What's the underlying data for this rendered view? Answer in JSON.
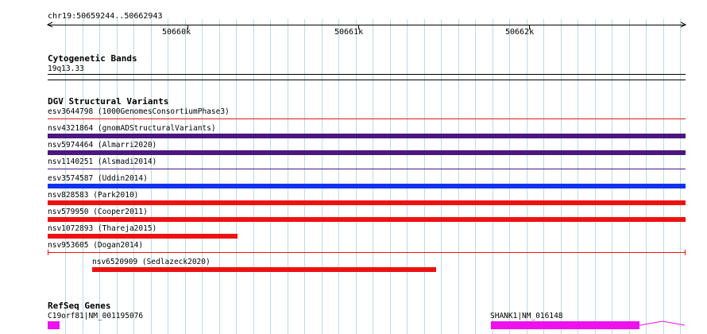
{
  "ruler": {
    "location": "chr19:50659244..50662943",
    "ticks": [
      "50660k",
      "50661k",
      "50662k"
    ]
  },
  "cytoband_track": {
    "title": "Cytogenetic Bands",
    "band": "19q13.33"
  },
  "dgv_track": {
    "title": "DGV Structural Variants",
    "features": [
      {
        "label": "esv3644798 (1000GenomesConsortiumPhase3)",
        "color": "#e01b1b",
        "style": "thin"
      },
      {
        "label": "nsv4321864 (gnomADStructuralVariants)",
        "color": "#4b1780",
        "style": "thick"
      },
      {
        "label": "nsv5974464 (Almarri2020)",
        "color": "#4b1780",
        "style": "thick"
      },
      {
        "label": "nsv1140251 (Alsmadi2014)",
        "color": "#4b1780",
        "style": "thin"
      },
      {
        "label": "esv3574587 (Uddin2014)",
        "color": "#1133ee",
        "style": "thick"
      },
      {
        "label": "nsv828583 (Park2010)",
        "color": "#ee1111",
        "style": "thick"
      },
      {
        "label": "nsv579950 (Cooper2011)",
        "color": "#ee1111",
        "style": "thick"
      },
      {
        "label": "nsv1072893 (Thareja2015)",
        "color": "#ee1111",
        "style": "thick"
      },
      {
        "label": "nsv953605 (Dogan2014)",
        "color": "#ee1111",
        "style": "thin"
      },
      {
        "label": "nsv6520909 (Sedlazeck2020)",
        "color": "#ee1111",
        "style": "thick"
      }
    ]
  },
  "refseq_track": {
    "title": "RefSeq Genes",
    "genes": [
      {
        "label": "C19orf81|NM_001195076",
        "color": "#ee11ee"
      },
      {
        "label": "SHANK1|NM_016148",
        "color": "#ee11ee"
      }
    ]
  }
}
